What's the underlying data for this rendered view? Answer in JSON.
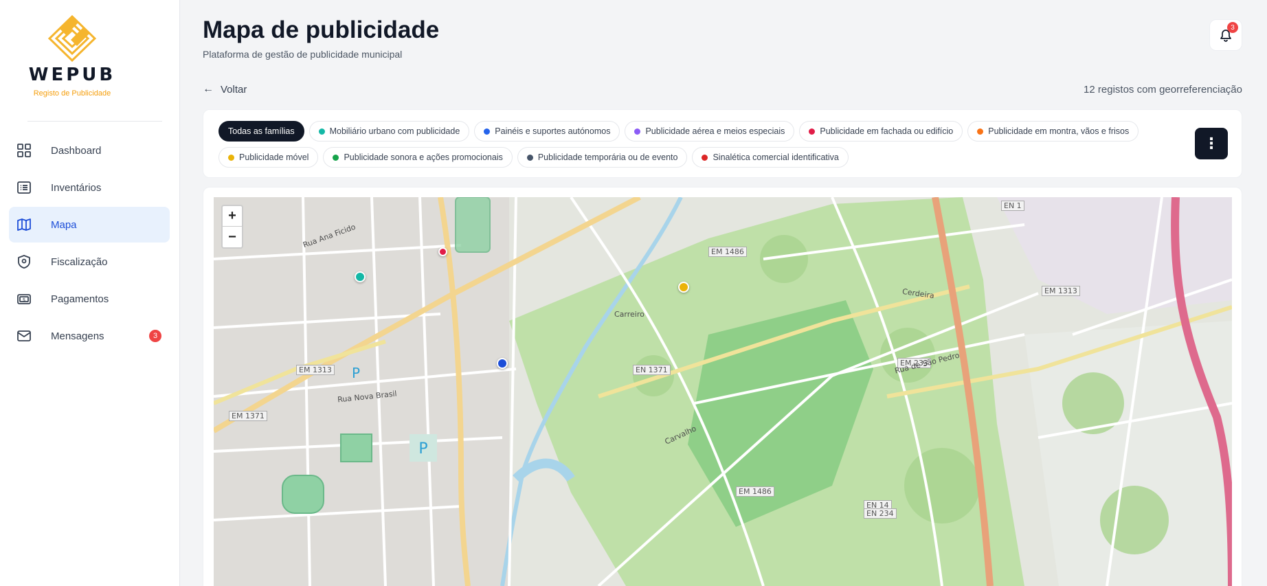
{
  "brand": {
    "name": "WEPUB",
    "subtitle": "Registo de Publicidade",
    "accent": "#f5b52e"
  },
  "nav": {
    "items": [
      {
        "label": "Dashboard",
        "icon": "grid-icon",
        "active": false
      },
      {
        "label": "Inventários",
        "icon": "list-icon",
        "active": false
      },
      {
        "label": "Mapa",
        "icon": "map-icon",
        "active": true
      },
      {
        "label": "Fiscalização",
        "icon": "shield-icon",
        "active": false
      },
      {
        "label": "Pagamentos",
        "icon": "banknote-icon",
        "active": false
      },
      {
        "label": "Mensagens",
        "icon": "mail-icon",
        "active": false,
        "badge": "3"
      }
    ]
  },
  "header": {
    "title": "Mapa de publicidade",
    "subtitle": "Plataforma de gestão de publicidade municipal",
    "notifications_count": "3"
  },
  "toolbar": {
    "back_label": "Voltar",
    "records_text": "12 registos com georreferenciação"
  },
  "filters": {
    "chips": [
      {
        "label": "Todas as famílias",
        "color": "",
        "active": true
      },
      {
        "label": "Mobiliário urbano com publicidade",
        "color": "#14b8a6",
        "active": false
      },
      {
        "label": "Painéis e suportes autónomos",
        "color": "#2563eb",
        "active": false
      },
      {
        "label": "Publicidade aérea e meios especiais",
        "color": "#8b5cf6",
        "active": false
      },
      {
        "label": "Publicidade em fachada ou edifício",
        "color": "#e11d48",
        "active": false
      },
      {
        "label": "Publicidade em montra, vãos e frisos",
        "color": "#f97316",
        "active": false
      },
      {
        "label": "Publicidade móvel",
        "color": "#eab308",
        "active": false
      },
      {
        "label": "Publicidade sonora e ações promocionais",
        "color": "#16a34a",
        "active": false
      },
      {
        "label": "Publicidade temporária ou de evento",
        "color": "#475569",
        "active": false
      },
      {
        "label": "Sinalética comercial identificativa",
        "color": "#dc2626",
        "active": false
      }
    ]
  },
  "map": {
    "zoom_in": "+",
    "zoom_out": "−",
    "road_labels": [
      "EM 1486",
      "EM 1313",
      "EN 1371",
      "EM 1371",
      "EM 233",
      "EM 1313",
      "EM 1486",
      "EN 14",
      "EN 234",
      "EN 1"
    ],
    "street_labels": [
      "Rua Ana Ficido",
      "Rua de São Pedro",
      "Carreiro",
      "Rua Nova Brasil",
      "Cerdeira",
      "Carvalho"
    ],
    "markers": [
      {
        "color": "#e11d48"
      },
      {
        "color": "#14b8a6"
      },
      {
        "color": "#eab308"
      },
      {
        "color": "#1d4ed8"
      }
    ]
  }
}
